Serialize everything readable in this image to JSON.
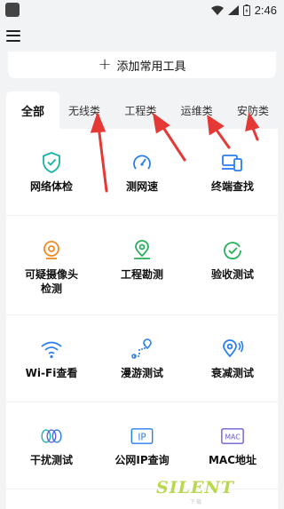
{
  "status_bar": {
    "time": "2:46"
  },
  "add_bar": {
    "label": "添加常用工具"
  },
  "tabs": [
    {
      "label": "全部",
      "active": true
    },
    {
      "label": "无线类",
      "active": false
    },
    {
      "label": "工程类",
      "active": false
    },
    {
      "label": "运维类",
      "active": false
    },
    {
      "label": "安防类",
      "active": false
    }
  ],
  "tools": [
    {
      "label": "网络体检",
      "icon": "shield-check-icon",
      "color": "#17b3a3"
    },
    {
      "label": "测网速",
      "icon": "speedometer-icon",
      "color": "#2a7ef0"
    },
    {
      "label": "终端查找",
      "icon": "devices-icon",
      "color": "#2a7ef0"
    },
    {
      "label": "可疑摄像头\n检测",
      "icon": "camera-icon",
      "color": "#f08a24"
    },
    {
      "label": "工程勘测",
      "icon": "map-pin-icon",
      "color": "#27b05a"
    },
    {
      "label": "验收测试",
      "icon": "check-circle-icon",
      "color": "#27b05a"
    },
    {
      "label": "Wi-Fi查看",
      "icon": "wifi-icon",
      "color": "#2a7ef0"
    },
    {
      "label": "漫游测试",
      "icon": "roaming-path-icon",
      "color": "#2a7ef0"
    },
    {
      "label": "衰减测试",
      "icon": "signal-pin-icon",
      "color": "#2a7ef0"
    },
    {
      "label": "干扰测试",
      "icon": "interference-rings-icon",
      "color": "#17b3a3"
    },
    {
      "label": "公网IP查询",
      "icon": "ip-box-icon",
      "color": "#2a7ef0"
    },
    {
      "label": "MAC地址",
      "icon": "mac-box-icon",
      "color": "#6b5fd3"
    }
  ],
  "watermark": {
    "text": "SILENT",
    "sub": "下载"
  },
  "colors": {
    "arrow": "#e53935",
    "accent_blue": "#2a7ef0"
  }
}
